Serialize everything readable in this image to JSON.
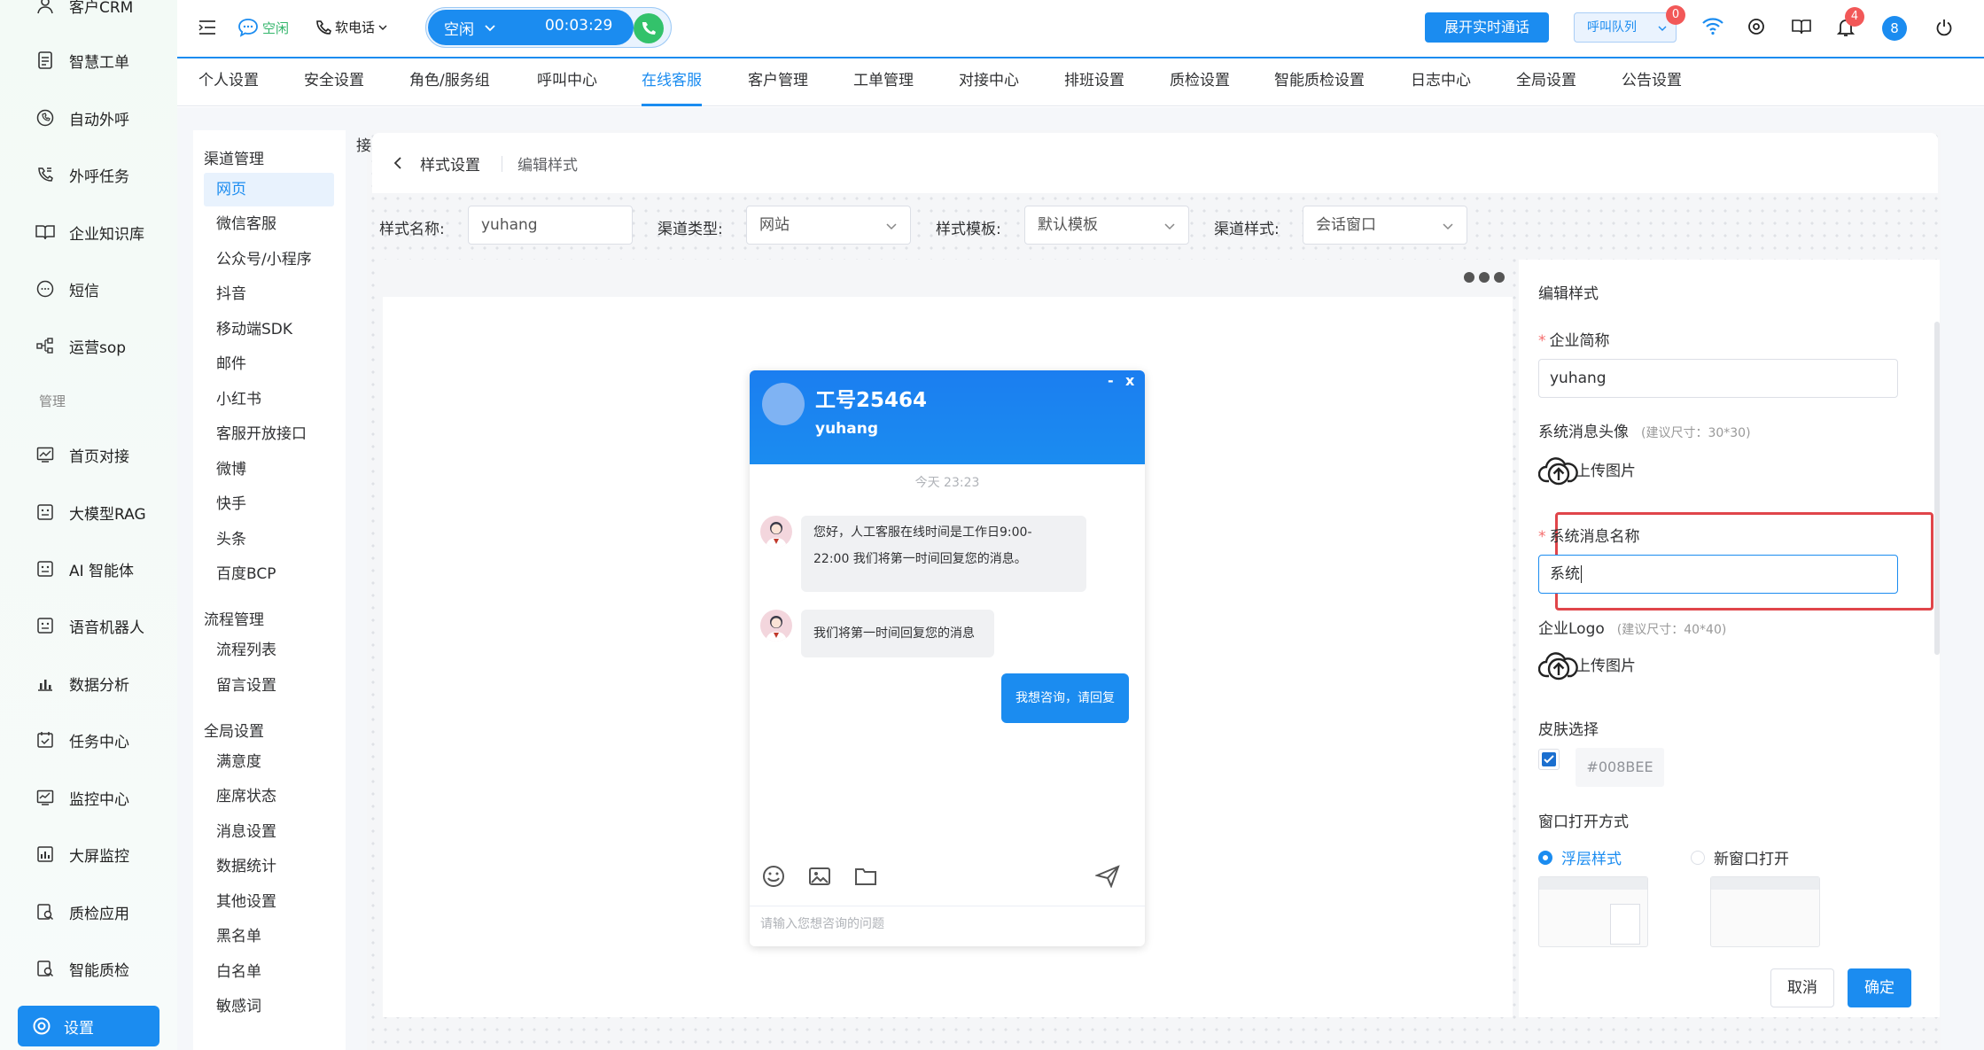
{
  "sidebar": {
    "items": [
      {
        "label": "客户CRM",
        "icon": "user-icon"
      },
      {
        "label": "智慧工单",
        "icon": "document-icon"
      },
      {
        "label": "自动外呼",
        "icon": "phone-icon"
      },
      {
        "label": "外呼任务",
        "icon": "phone-task-icon"
      },
      {
        "label": "企业知识库",
        "icon": "book-icon"
      },
      {
        "label": "短信",
        "icon": "sms-icon"
      },
      {
        "label": "运营sop",
        "icon": "flow-icon"
      }
    ],
    "group_label": "管理",
    "manage_items": [
      {
        "label": "首页对接",
        "icon": "chart-icon"
      },
      {
        "label": "大模型RAG",
        "icon": "robot-icon"
      },
      {
        "label": "AI 智能体",
        "icon": "robot-icon"
      },
      {
        "label": "语音机器人",
        "icon": "robot-icon"
      },
      {
        "label": "数据分析",
        "icon": "bar-chart-icon"
      },
      {
        "label": "任务中心",
        "icon": "calendar-check-icon"
      },
      {
        "label": "监控中心",
        "icon": "monitor-icon"
      },
      {
        "label": "大屏监控",
        "icon": "screen-icon"
      },
      {
        "label": "质检应用",
        "icon": "inspect-icon"
      },
      {
        "label": "智能质检",
        "icon": "inspect-icon"
      }
    ],
    "active_item": {
      "label": "设置",
      "icon": "gear-icon"
    }
  },
  "header": {
    "status_text": "空闲",
    "softphone_label": "软电话",
    "call_state": "空闲",
    "timer": "00:03:29",
    "realtime_button": "展开实时通话",
    "queue_label": "呼叫队列",
    "queue_badge": "0",
    "notify_badge": "4",
    "user_initial": "8"
  },
  "tabs": [
    {
      "label": "个人设置"
    },
    {
      "label": "安全设置"
    },
    {
      "label": "角色/服务组"
    },
    {
      "label": "呼叫中心"
    },
    {
      "label": "在线客服",
      "active": true
    },
    {
      "label": "客户管理"
    },
    {
      "label": "工单管理"
    },
    {
      "label": "对接中心"
    },
    {
      "label": "排班设置"
    },
    {
      "label": "质检设置"
    },
    {
      "label": "智能质检设置"
    },
    {
      "label": "日志中心"
    },
    {
      "label": "全局设置"
    },
    {
      "label": "公告设置"
    }
  ],
  "channels": {
    "group1": "渠道管理",
    "group1_items": [
      "网页",
      "微信客服",
      "公众号/小程序",
      "抖音",
      "移动端SDK",
      "邮件",
      "小红书",
      "客服开放接口",
      "微博",
      "快手",
      "头条",
      "百度BCP"
    ],
    "group2": "流程管理",
    "group2_items": [
      "流程列表",
      "留言设置"
    ],
    "group3": "全局设置",
    "group3_items": [
      "满意度",
      "座席状态",
      "消息设置",
      "数据统计",
      "其他设置",
      "黑名单",
      "白名单",
      "敏感词"
    ],
    "active": "网页"
  },
  "breadcrumb": {
    "cut_char": "接",
    "back": "样式设置",
    "current": "编辑样式"
  },
  "form": {
    "name_label": "样式名称:",
    "name_value": "yuhang",
    "channel_type_label": "渠道类型:",
    "channel_type_value": "网站",
    "template_label": "样式模板:",
    "template_value": "默认模板",
    "channel_style_label": "渠道样式:",
    "channel_style_value": "会话窗口"
  },
  "chat": {
    "agent_title": "工号25464",
    "agent_sub": "yuhang",
    "minimize": "-",
    "close": "x",
    "time": "今天 23:23",
    "msg1_line1": "您好，人工客服在线时间是工作日9:00-",
    "msg1_line2": "22:00 我们将第一时间回复您的消息。",
    "msg2": "我们将第一时间回复您的消息",
    "msg3": "我想咨询，请回复",
    "input_placeholder": "请输入您想咨询的问题"
  },
  "edit": {
    "title": "编辑样式",
    "company_label": "企业简称",
    "company_value": "yuhang",
    "avatar_label": "系统消息头像",
    "avatar_hint": "(建议尺寸：30*30)",
    "upload_label": "上传图片",
    "sysname_label": "系统消息名称",
    "sysname_value": "系统",
    "logo_label": "企业Logo",
    "logo_hint": "(建议尺寸：40*40)",
    "upload_label2": "上传图片",
    "skin_label": "皮肤选择",
    "skin_color": "#008BEE",
    "open_label": "窗口打开方式",
    "open_opt1": "浮层样式",
    "open_opt2": "新窗口打开",
    "cancel": "取消",
    "confirm": "确定"
  },
  "colors": {
    "primary": "#1b8cf0",
    "highlight_border": "#e0454a",
    "badge": "#f25858",
    "green_call": "#33c26b"
  }
}
